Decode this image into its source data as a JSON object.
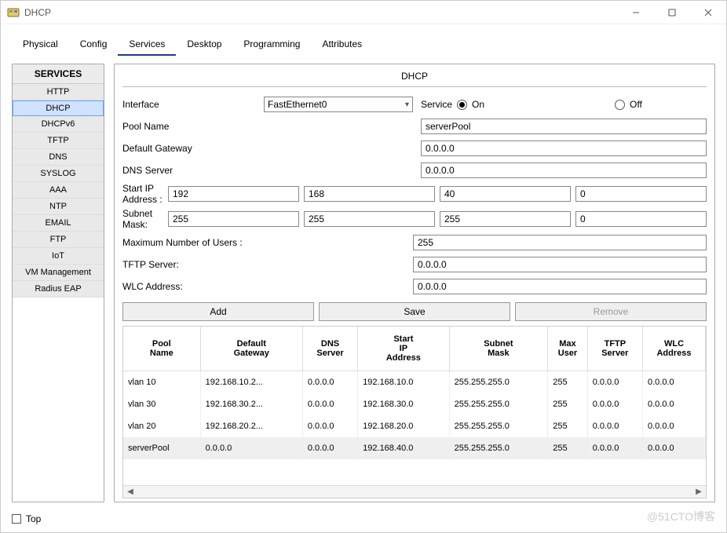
{
  "window": {
    "title": "DHCP"
  },
  "tabs": [
    "Physical",
    "Config",
    "Services",
    "Desktop",
    "Programming",
    "Attributes"
  ],
  "activeTab": 2,
  "sidebar": {
    "header": "SERVICES",
    "items": [
      "HTTP",
      "DHCP",
      "DHCPv6",
      "TFTP",
      "DNS",
      "SYSLOG",
      "AAA",
      "NTP",
      "EMAIL",
      "FTP",
      "IoT",
      "VM Management",
      "Radius EAP"
    ],
    "selectedIndex": 1
  },
  "pane": {
    "title": "DHCP",
    "labels": {
      "interface": "Interface",
      "service": "Service",
      "on": "On",
      "off": "Off",
      "poolName": "Pool Name",
      "defaultGateway": "Default Gateway",
      "dnsServer": "DNS Server",
      "startIp": "Start IP Address :",
      "subnet": "Subnet Mask:",
      "maxUsers": "Maximum Number of Users :",
      "tftp": "TFTP Server:",
      "wlc": "WLC Address:"
    },
    "interfaceValue": "FastEthernet0",
    "serviceOn": true,
    "poolName": "serverPool",
    "defaultGateway": "0.0.0.0",
    "dnsServer": "0.0.0.0",
    "startIp": [
      "192",
      "168",
      "40",
      "0"
    ],
    "subnet": [
      "255",
      "255",
      "255",
      "0"
    ],
    "maxUsers": "255",
    "tftp": "0.0.0.0",
    "wlc": "0.0.0.0",
    "buttons": {
      "add": "Add",
      "save": "Save",
      "remove": "Remove"
    }
  },
  "table": {
    "headers": [
      "Pool Name",
      "Default Gateway",
      "DNS Server",
      "Start IP Address",
      "Subnet Mask",
      "Max User",
      "TFTP Server",
      "WLC Address"
    ],
    "headersMultiline": [
      [
        "Pool",
        "Name"
      ],
      [
        "Default",
        "Gateway"
      ],
      [
        "DNS",
        "Server"
      ],
      [
        "Start",
        "IP",
        "Address"
      ],
      [
        "Subnet",
        "Mask"
      ],
      [
        "Max",
        "User"
      ],
      [
        "TFTP",
        "Server"
      ],
      [
        "WLC",
        "Address"
      ]
    ],
    "rows": [
      {
        "pool": "vlan 10",
        "gw": "192.168.10.2...",
        "dns": "0.0.0.0",
        "start": "192.168.10.0",
        "mask": "255.255.255.0",
        "max": "255",
        "tftp": "0.0.0.0",
        "wlc": "0.0.0.0"
      },
      {
        "pool": "vlan 30",
        "gw": "192.168.30.2...",
        "dns": "0.0.0.0",
        "start": "192.168.30.0",
        "mask": "255.255.255.0",
        "max": "255",
        "tftp": "0.0.0.0",
        "wlc": "0.0.0.0"
      },
      {
        "pool": "vlan 20",
        "gw": "192.168.20.2...",
        "dns": "0.0.0.0",
        "start": "192.168.20.0",
        "mask": "255.255.255.0",
        "max": "255",
        "tftp": "0.0.0.0",
        "wlc": "0.0.0.0"
      },
      {
        "pool": "serverPool",
        "gw": "0.0.0.0",
        "dns": "0.0.0.0",
        "start": "192.168.40.0",
        "mask": "255.255.255.0",
        "max": "255",
        "tftp": "0.0.0.0",
        "wlc": "0.0.0.0"
      }
    ],
    "selectedRow": 3
  },
  "bottom": {
    "topLabel": "Top"
  },
  "watermark": "@51CTO博客"
}
